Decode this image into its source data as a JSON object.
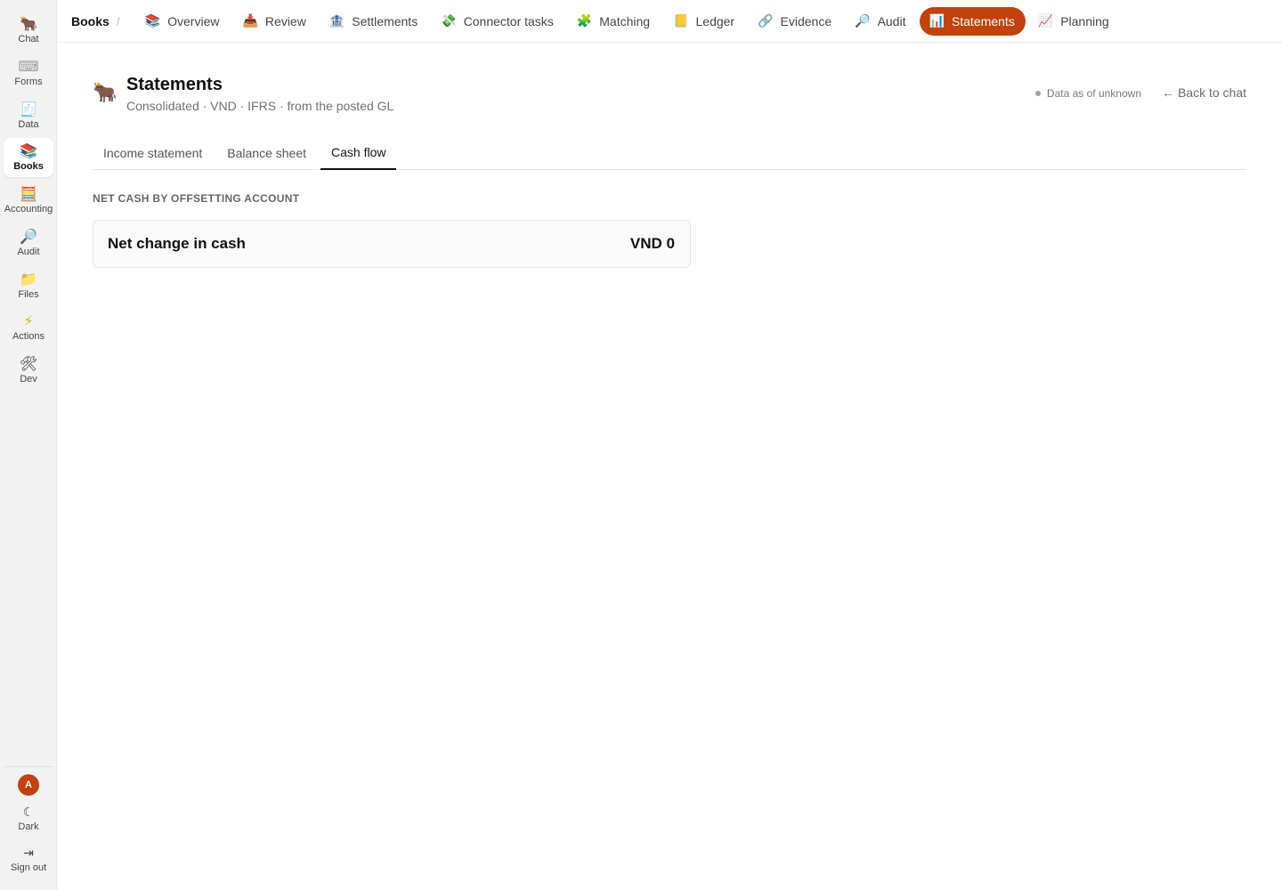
{
  "sidebar": {
    "items": [
      {
        "icon": "🐂",
        "label": "Chat"
      },
      {
        "icon": "⌨",
        "label": "Forms"
      },
      {
        "icon": "🧾",
        "label": "Data"
      },
      {
        "icon": "📚",
        "label": "Books"
      },
      {
        "icon": "🧮",
        "label": "Accounting"
      },
      {
        "icon": "🔎",
        "label": "Audit"
      },
      {
        "icon": "📁",
        "label": "Files"
      },
      {
        "icon": "⚡",
        "label": "Actions"
      },
      {
        "icon": "🛠",
        "label": "Dev"
      }
    ],
    "active": "Books",
    "avatar_initial": "A",
    "theme": {
      "icon": "☾",
      "label": "Dark"
    },
    "signout": {
      "icon": "⇥",
      "label": "Sign out"
    }
  },
  "topbar": {
    "breadcrumb": "Books",
    "separator": "/",
    "tabs": [
      {
        "icon": "📚",
        "label": "Overview"
      },
      {
        "icon": "📥",
        "label": "Review"
      },
      {
        "icon": "🏦",
        "label": "Settlements"
      },
      {
        "icon": "💸",
        "label": "Connector tasks"
      },
      {
        "icon": "🧩",
        "label": "Matching"
      },
      {
        "icon": "📒",
        "label": "Ledger"
      },
      {
        "icon": "🔗",
        "label": "Evidence"
      },
      {
        "icon": "🔎",
        "label": "Audit"
      },
      {
        "icon": "📊",
        "label": "Statements"
      },
      {
        "icon": "📈",
        "label": "Planning"
      }
    ],
    "active": "Statements"
  },
  "header": {
    "icon": "🐂",
    "title": "Statements",
    "subtitle": "Consolidated · VND · IFRS · from the posted GL",
    "data_status": "Data as of unknown",
    "back_link": "← Back to chat"
  },
  "tabs": {
    "items": [
      "Income statement",
      "Balance sheet",
      "Cash flow"
    ],
    "active": "Cash flow"
  },
  "cash_flow": {
    "section_label": "NET CASH BY OFFSETTING ACCOUNT",
    "row_label": "Net change in cash",
    "row_value": "VND 0"
  },
  "colors": {
    "accent": "#c2410c",
    "sidebar_bg": "#f2f2f2"
  }
}
